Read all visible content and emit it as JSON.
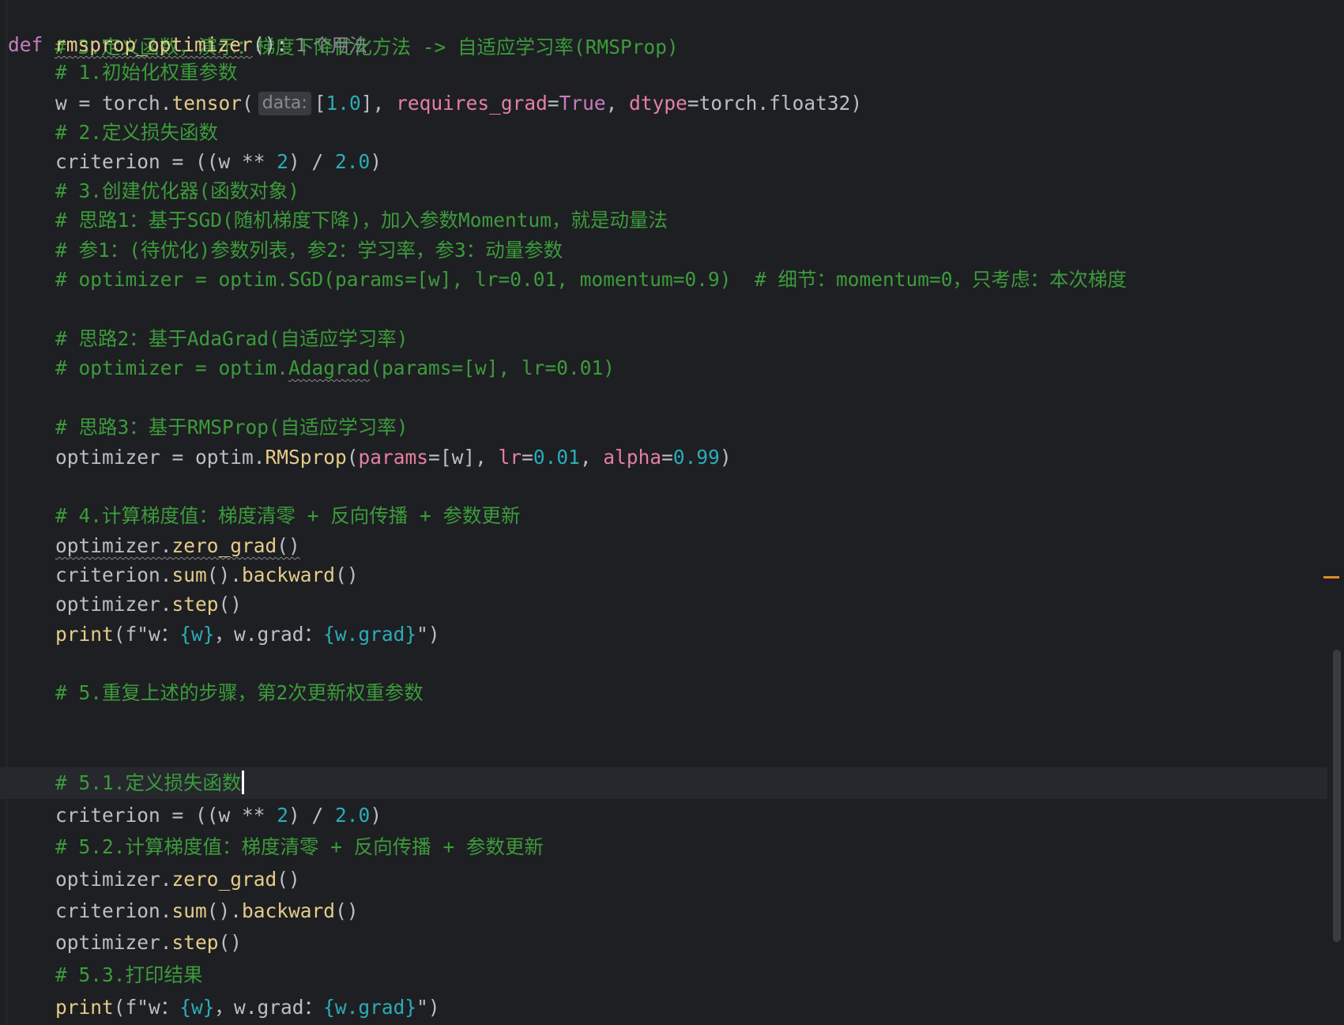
{
  "editor": {
    "inlay_usage_hint": "1 个用法",
    "inlay_param_hint": "data:",
    "lines": {
      "l0": "# 3.定义函数，演示：梯度下降优化方法 -> 自适应学习率(RMSProp)",
      "l1_def": "def",
      "l1_name": "rmsprop_optimizer",
      "l1_tail": "():",
      "l2": "# 1.初始化权重参数",
      "l3_a": "w = torch.",
      "l3_fn": "tensor",
      "l3_b": "(",
      "l3_c": "[",
      "l3_num": "1.0",
      "l3_d": "], ",
      "l3_p1": "requires_grad",
      "l3_e": "=",
      "l3_kw": "True",
      "l3_f": ", ",
      "l3_p2": "dtype",
      "l3_g": "=torch.float32)",
      "l4": "# 2.定义损失函数",
      "l5_a": "criterion = ((w ** ",
      "l5_n1": "2",
      "l5_b": ") / ",
      "l5_n2": "2.0",
      "l5_c": ")",
      "l6": "# 3.创建优化器(函数对象)",
      "l7": "# 思路1：基于SGD(随机梯度下降)，加入参数Momentum，就是动量法",
      "l8": "# 参1：(待优化)参数列表，参2：学习率，参3：动量参数",
      "l9": "# optimizer = optim.SGD(params=[w], lr=0.01, momentum=0.9)  # 细节：momentum=0，只考虑：本次梯度",
      "l11": "# 思路2：基于AdaGrad(自适应学习率)",
      "l12_a": "# optimizer = optim.",
      "l12_sq": "Adagrad",
      "l12_b": "(params=[w], lr=0.01)",
      "l14": "# 思路3：基于RMSProp(自适应学习率)",
      "l15_a": "optimizer = optim.",
      "l15_fn": "RMSprop",
      "l15_b": "(",
      "l15_p1": "params",
      "l15_c": "=[w], ",
      "l15_p2": "lr",
      "l15_d": "=",
      "l15_n1": "0.01",
      "l15_e": ", ",
      "l15_p3": "alpha",
      "l15_f": "=",
      "l15_n2": "0.99",
      "l15_g": ")",
      "l17": "# 4.计算梯度值：梯度清零 + 反向传播 + 参数更新",
      "l18_a": "optimizer.",
      "l18_fn": "zero_grad",
      "l18_b": "()",
      "l19_a": "criterion.",
      "l19_fn1": "sum",
      "l19_b": "().",
      "l19_fn2": "backward",
      "l19_c": "()",
      "l20_a": "optimizer.",
      "l20_fn": "step",
      "l20_b": "()",
      "l21_fn": "print",
      "l21_a": "(f\"w：",
      "l21_v1": "{w}",
      "l21_b": "，w.grad：",
      "l21_v2": "{w.grad}",
      "l21_c": "\")",
      "l23": "# 5.重复上述的步骤，第2次更新权重参数",
      "l24": "# 5.1.定义损失函数",
      "l25_a": "criterion = ((w ** ",
      "l25_n1": "2",
      "l25_b": ") / ",
      "l25_n2": "2.0",
      "l25_c": ")",
      "l26": "# 5.2.计算梯度值：梯度清零 + 反向传播 + 参数更新",
      "l27_a": "optimizer.",
      "l27_fn": "zero_grad",
      "l27_b": "()",
      "l28_a": "criterion.",
      "l28_fn1": "sum",
      "l28_b": "().",
      "l28_fn2": "backward",
      "l28_c": "()",
      "l29_a": "optimizer.",
      "l29_fn": "step",
      "l29_b": "()",
      "l30": "# 5.3.打印结果",
      "l31_fn": "print",
      "l31_a": "(f\"w：",
      "l31_v1": "{w}",
      "l31_b": "，w.grad：",
      "l31_v2": "{w.grad}",
      "l31_c": "\")"
    }
  },
  "colors": {
    "background": "#1e1f22",
    "comment": "#3c9b3c",
    "keyword": "#c77dbb",
    "function": "#e6cc8a",
    "number": "#2aacb8",
    "parameter": "#e5809f",
    "text": "#bcbec4",
    "scroll_marker": "#e0892a"
  }
}
